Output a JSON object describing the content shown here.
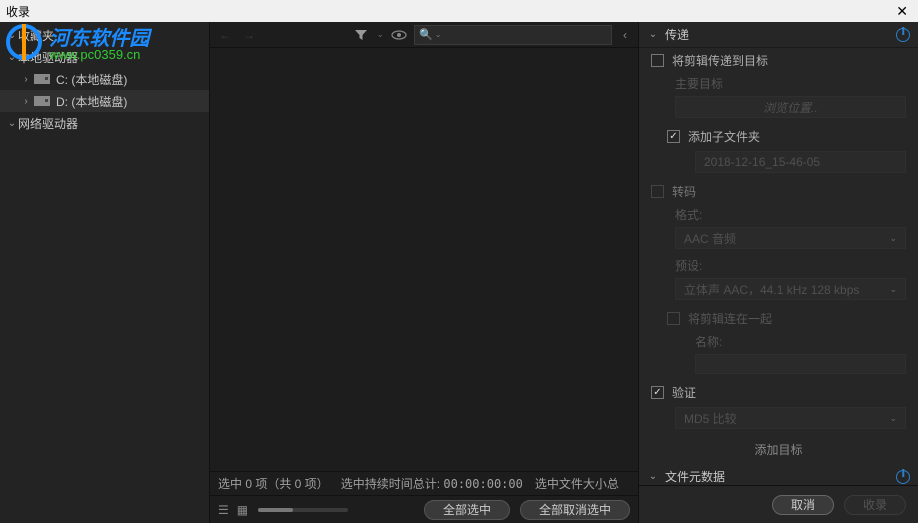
{
  "title": "收录",
  "watermark": {
    "cn": "河东软件园",
    "url": "www.pc0359.cn"
  },
  "sidebar": {
    "favorites": "收藏夹",
    "local_drive": "本地驱动器",
    "drives": [
      {
        "label": "C: (本地磁盘)"
      },
      {
        "label": "D: (本地磁盘)"
      }
    ],
    "network_drive": "网络驱动器"
  },
  "status": {
    "selected": "选中 0 项（共 0 项）",
    "duration_label": "选中持续时间总计:",
    "duration_value": "00:00:00:00",
    "size_label": "选中文件大小总"
  },
  "buttons": {
    "select_all": "全部选中",
    "deselect_all": "全部取消选中",
    "cancel": "取消",
    "ingest": "收录"
  },
  "right": {
    "transfer": {
      "title": "传递",
      "send_to_target": "将剪辑传递到目标",
      "primary_target": "主要目标",
      "browse": "浏览位置..",
      "add_subfolder": "添加子文件夹",
      "subfolder_value": "2018-12-16_15-46-05",
      "transcode": "转码",
      "format_label": "格式:",
      "format_value": "AAC 音频",
      "preset_label": "预设:",
      "preset_value": "立体声 AAC，44.1 kHz 128 kbps",
      "join_clips": "将剪辑连在一起",
      "name_label": "名称:",
      "verify": "验证",
      "verify_value": "MD5 比较",
      "add_target": "添加目标"
    },
    "metadata": {
      "title": "文件元数据"
    }
  }
}
